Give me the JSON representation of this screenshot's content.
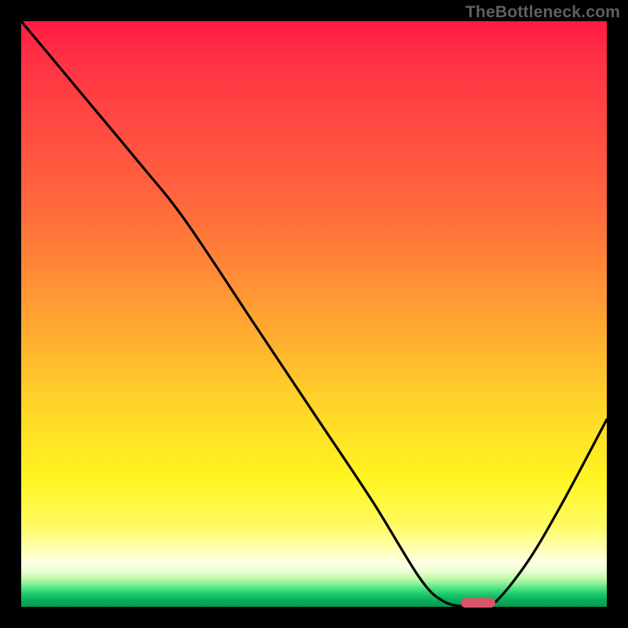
{
  "watermark": "TheBottleneck.com",
  "colors": {
    "top": "#ff1a42",
    "mid": "#ffd02a",
    "bottom": "#069a50",
    "curve": "#000000",
    "marker": "#d9536a",
    "frame": "#000000"
  },
  "chart_data": {
    "type": "line",
    "title": "",
    "xlabel": "",
    "ylabel": "",
    "xlim": [
      0,
      100
    ],
    "ylim": [
      0,
      100
    ],
    "grid": false,
    "legend": false,
    "series": [
      {
        "name": "bottleneck-curve",
        "x": [
          0,
          10,
          20,
          28,
          40,
          50,
          60,
          68,
          72,
          76,
          80,
          86,
          92,
          100
        ],
        "y": [
          100,
          88,
          76,
          66,
          48,
          33,
          18,
          5,
          1,
          0,
          0,
          7,
          17,
          32
        ]
      }
    ],
    "optimum_marker": {
      "x_start": 75,
      "x_end": 81,
      "y": 0.7
    }
  }
}
